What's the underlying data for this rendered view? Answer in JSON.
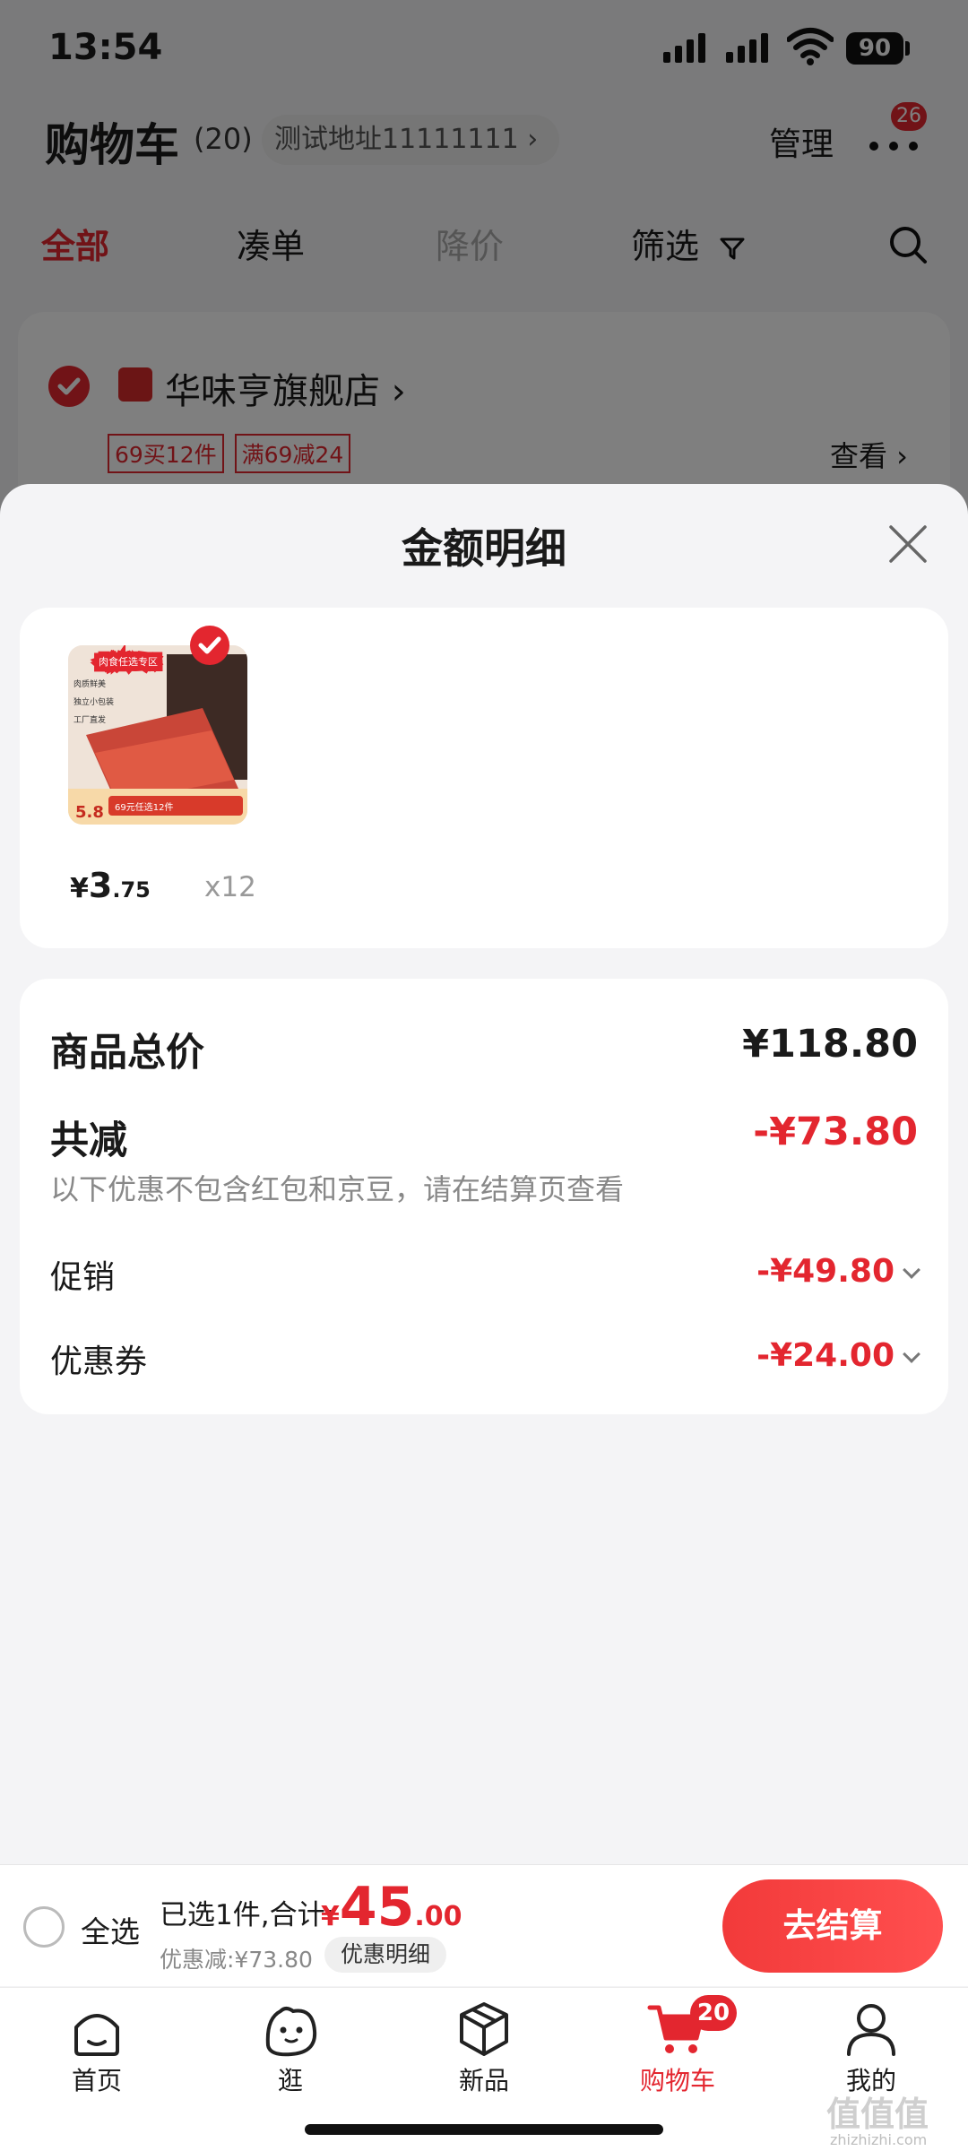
{
  "status_bar": {
    "time": "13:54",
    "battery": "90"
  },
  "header": {
    "title": "购物车",
    "count": "(20)",
    "address": "测试地址11111111 ›",
    "manage": "管理",
    "message_badge": "26"
  },
  "tabs": [
    {
      "label": "全部"
    },
    {
      "label": "凑单"
    },
    {
      "label": "降价"
    },
    {
      "label": "筛选"
    }
  ],
  "store": {
    "name": "华味亨旗舰店 ›",
    "tags": [
      "69买12件",
      "满69减24"
    ],
    "view": "查看 ›"
  },
  "sheet": {
    "title": "金额明细",
    "product": {
      "price_currency": "¥",
      "price_int": "3",
      "price_dec": ".75",
      "quantity": "x12",
      "thumb_text": {
        "banner": "肉食任选专区",
        "line1": "肉质鲜美",
        "line2": "独立小包装",
        "line3": "工厂直发",
        "price": "5.8",
        "promo": "69元任选12件"
      }
    },
    "summary": {
      "total_label": "商品总价",
      "total_value": "¥118.80",
      "reduce_label": "共减",
      "reduce_value": "-¥73.80",
      "note": "以下优惠不包含红包和京豆，请在结算页查看",
      "promo_label": "促销",
      "promo_value": "-¥49.80",
      "coupon_label": "优惠券",
      "coupon_value": "-¥24.00"
    }
  },
  "bottom_bar": {
    "select_all": "全选",
    "selected": "已选1件,合计:",
    "total_currency": "¥",
    "total_int": "45",
    "total_dec": ".00",
    "discount": "优惠减:¥73.80",
    "detail": "优惠明细",
    "checkout": "去结算"
  },
  "tabbar": {
    "items": [
      {
        "label": "首页",
        "icon": "home-icon"
      },
      {
        "label": "逛",
        "icon": "browse-icon"
      },
      {
        "label": "新品",
        "icon": "box-icon"
      },
      {
        "label": "购物车",
        "icon": "cart-icon",
        "badge": "20"
      },
      {
        "label": "我的",
        "icon": "user-icon"
      }
    ]
  },
  "watermark": {
    "main": "值值值",
    "sub": "zhizhizhi.com"
  },
  "colors": {
    "accent": "#e3262f",
    "background": "#f4f4f6"
  }
}
